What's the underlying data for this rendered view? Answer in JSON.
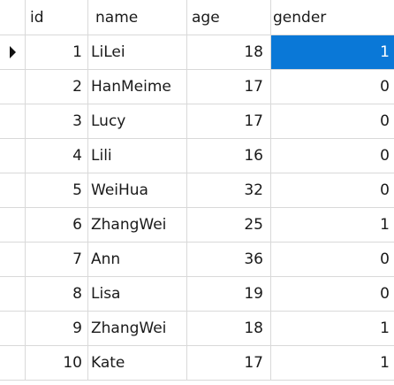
{
  "table": {
    "columns": [
      "id",
      "name",
      "age",
      "gender"
    ],
    "selected": {
      "row": 0,
      "column": "gender"
    },
    "rows": [
      {
        "id": "1",
        "name": "LiLei",
        "age": "18",
        "gender": "1"
      },
      {
        "id": "2",
        "name": "HanMeime",
        "age": "17",
        "gender": "0"
      },
      {
        "id": "3",
        "name": "Lucy",
        "age": "17",
        "gender": "0"
      },
      {
        "id": "4",
        "name": "Lili",
        "age": "16",
        "gender": "0"
      },
      {
        "id": "5",
        "name": "WeiHua",
        "age": "32",
        "gender": "0"
      },
      {
        "id": "6",
        "name": "ZhangWei",
        "age": "25",
        "gender": "1"
      },
      {
        "id": "7",
        "name": "Ann",
        "age": "36",
        "gender": "0"
      },
      {
        "id": "8",
        "name": "Lisa",
        "age": "19",
        "gender": "0"
      },
      {
        "id": "9",
        "name": "ZhangWei",
        "age": "18",
        "gender": "1"
      },
      {
        "id": "10",
        "name": "Kate",
        "age": "17",
        "gender": "1"
      }
    ]
  },
  "colors": {
    "selection": "#0a78d7",
    "grid_line": "#d9d9d9"
  },
  "icons": {
    "current_row_indicator": "right-triangle"
  }
}
